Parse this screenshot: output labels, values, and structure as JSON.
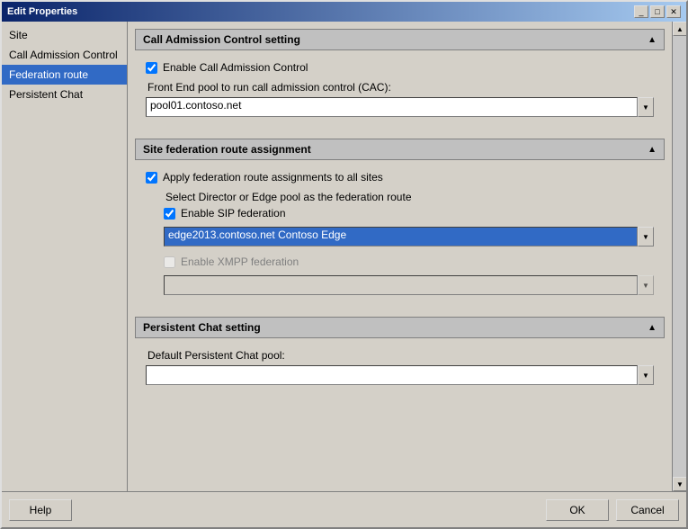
{
  "window": {
    "title": "Edit Properties",
    "controls": [
      "_",
      "□",
      "✕"
    ]
  },
  "sidebar": {
    "items": [
      {
        "id": "site",
        "label": "Site",
        "active": false
      },
      {
        "id": "call-admission-control",
        "label": "Call Admission Control",
        "active": false
      },
      {
        "id": "federation-route",
        "label": "Federation route",
        "active": true
      },
      {
        "id": "persistent-chat",
        "label": "Persistent Chat",
        "active": false
      }
    ]
  },
  "sections": {
    "call_admission": {
      "header": "Call Admission Control setting",
      "enable_cac_label": "Enable Call Admission Control",
      "enable_cac_checked": true,
      "front_end_label": "Front End pool to run call admission control (CAC):",
      "front_end_value": "pool01.contoso.net"
    },
    "site_federation": {
      "header": "Site federation route assignment",
      "apply_all_label": "Apply federation route assignments to all sites",
      "apply_all_checked": true,
      "select_director_label": "Select Director or Edge pool as the federation route",
      "enable_sip_label": "Enable SIP federation",
      "enable_sip_checked": true,
      "sip_value": "edge2013.contoso.net    Contoso   Edge",
      "enable_xmpp_label": "Enable XMPP federation",
      "enable_xmpp_checked": false,
      "xmpp_value": ""
    },
    "persistent_chat": {
      "header": "Persistent Chat setting",
      "default_pool_label": "Default Persistent Chat pool:",
      "default_pool_value": ""
    }
  },
  "footer": {
    "help_label": "Help",
    "ok_label": "OK",
    "cancel_label": "Cancel"
  }
}
